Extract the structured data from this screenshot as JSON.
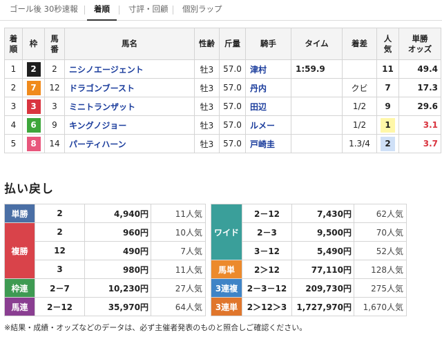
{
  "tabs": [
    {
      "label": "ゴール後 30秒速報",
      "active": false
    },
    {
      "label": "着順",
      "active": true
    },
    {
      "label": "寸評・回顧",
      "active": false
    },
    {
      "label": "個別ラップ",
      "active": false
    }
  ],
  "results": {
    "headers": {
      "order": [
        "着",
        "順"
      ],
      "waku": "枠",
      "umaban": [
        "馬",
        "番"
      ],
      "name": "馬名",
      "sexage": "性齢",
      "weight": "斤量",
      "jockey": "騎手",
      "time": "タイム",
      "margin": "着差",
      "popularity": [
        "人",
        "気"
      ],
      "odds": [
        "単勝",
        "オッズ"
      ]
    },
    "rows": [
      {
        "order": "1",
        "waku": "2",
        "waku_bg": "#1f1f1f",
        "waku_fg": "#ffffff",
        "umaban": "2",
        "name": "ニシノエージェント",
        "sexage": "牡3",
        "weight": "57.0",
        "jockey": "津村",
        "time": "1:59.9",
        "margin": "",
        "popularity": "11",
        "pop_class": "",
        "odds": "49.4",
        "odds_hot": false
      },
      {
        "order": "2",
        "waku": "7",
        "waku_bg": "#f08a1c",
        "waku_fg": "#ffffff",
        "umaban": "12",
        "name": "ドラゴンブースト",
        "sexage": "牡3",
        "weight": "57.0",
        "jockey": "丹内",
        "time": "",
        "margin": "クビ",
        "popularity": "7",
        "pop_class": "",
        "odds": "17.3",
        "odds_hot": false
      },
      {
        "order": "3",
        "waku": "3",
        "waku_bg": "#d9343f",
        "waku_fg": "#ffffff",
        "umaban": "3",
        "name": "ミニトランザット",
        "sexage": "牡3",
        "weight": "57.0",
        "jockey": "田辺",
        "time": "",
        "margin": "1/2",
        "popularity": "9",
        "pop_class": "",
        "odds": "29.6",
        "odds_hot": false
      },
      {
        "order": "4",
        "waku": "6",
        "waku_bg": "#3da63b",
        "waku_fg": "#ffffff",
        "umaban": "9",
        "name": "キングノジョー",
        "sexage": "牡3",
        "weight": "57.0",
        "jockey": "ルメー",
        "time": "",
        "margin": "1/2",
        "popularity": "1",
        "pop_class": "p1",
        "odds": "3.1",
        "odds_hot": true
      },
      {
        "order": "5",
        "waku": "8",
        "waku_bg": "#e8567c",
        "waku_fg": "#ffffff",
        "umaban": "14",
        "name": "パーティハーン",
        "sexage": "牡3",
        "weight": "57.0",
        "jockey": "戸崎圭",
        "time": "",
        "margin": "1.3/4",
        "popularity": "2",
        "pop_class": "p2",
        "odds": "3.7",
        "odds_hot": true
      }
    ]
  },
  "payout": {
    "title": "払い戻し",
    "left": [
      {
        "label": "単勝",
        "color": "#4a6fa5",
        "rows": [
          {
            "comb": "2",
            "yen": "4,940円",
            "ninki": "11人気"
          }
        ]
      },
      {
        "label": "複勝",
        "color": "#d9434a",
        "rows": [
          {
            "comb": "2",
            "yen": "960円",
            "ninki": "10人気"
          },
          {
            "comb": "12",
            "yen": "490円",
            "ninki": "7人気"
          },
          {
            "comb": "3",
            "yen": "980円",
            "ninki": "11人気"
          }
        ]
      },
      {
        "label": "枠連",
        "color": "#3e9a52",
        "rows": [
          {
            "comb": "2－7",
            "yen": "10,230円",
            "ninki": "27人気"
          }
        ]
      },
      {
        "label": "馬連",
        "color": "#8a3e91",
        "rows": [
          {
            "comb": "2－12",
            "yen": "35,970円",
            "ninki": "64人気"
          }
        ]
      }
    ],
    "right": [
      {
        "label": "ワイド",
        "color": "#3a9f9a",
        "rows": [
          {
            "comb": "2－12",
            "yen": "7,430円",
            "ninki": "62人気"
          },
          {
            "comb": "2－3",
            "yen": "9,500円",
            "ninki": "70人気"
          },
          {
            "comb": "3－12",
            "yen": "5,490円",
            "ninki": "52人気"
          }
        ]
      },
      {
        "label": "馬単",
        "color": "#ec8a2c",
        "rows": [
          {
            "comb": "2＞12",
            "yen": "77,110円",
            "ninki": "128人気"
          }
        ]
      },
      {
        "label": "3連複",
        "color": "#3f84c6",
        "rows": [
          {
            "comb": "2－3－12",
            "yen": "209,730円",
            "ninki": "275人気"
          }
        ]
      },
      {
        "label": "3連単",
        "color": "#e0762c",
        "rows": [
          {
            "comb": "2＞12＞3",
            "yen": "1,727,970円",
            "ninki": "1,670人気"
          }
        ]
      }
    ]
  },
  "footnote": "※結果・成績・オッズなどのデータは、必ず主催者発表のものと照合しご確認ください。"
}
